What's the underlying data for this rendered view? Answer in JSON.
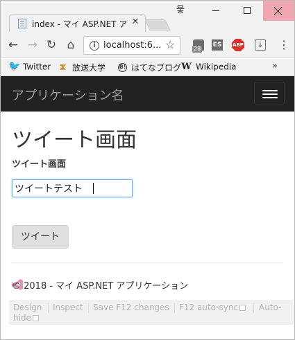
{
  "browser": {
    "tab_title": "index - マイ ASP.NET アプリ",
    "tab_close": "✕",
    "profile_glyph": "웋",
    "url": "localhost:6...",
    "star": "☆",
    "ext_badge": "28",
    "ext_es": "ES",
    "ext_abp": "ABP",
    "menu_dots": "⋮",
    "bookmarks": [
      {
        "label": "Twitter",
        "icon": "twitter-icon",
        "glyph": "🐦"
      },
      {
        "label": "放送大学",
        "icon": "housou-daigaku-icon",
        "glyph": "ⵣ"
      },
      {
        "label": "はてなブログ",
        "icon": "hatena-blog-icon",
        "glyph": "B!"
      },
      {
        "label": "Wikipedia",
        "icon": "wikipedia-icon",
        "glyph": "W"
      }
    ],
    "more_bookmarks": "»"
  },
  "app": {
    "brand": "アプリケーション名",
    "page_title": "ツイート画面",
    "field_label": "ツイート画面",
    "input_value": "ツイートテスト",
    "submit_label": "ツイート",
    "footer": "© 2018 - マイ ASP.NET アプリケーション"
  },
  "browser_link": {
    "design": "Design",
    "inspect": "Inspect",
    "save": "Save F12 changes",
    "autosync": "F12 auto-sync",
    "autohide_line1": "Auto-",
    "autohide_line2": "hide"
  },
  "colors": {
    "navbar": "#222222",
    "brand_text": "#9d9d9d",
    "close_button": "#f0a7b2",
    "input_focus": "#66afe9"
  }
}
